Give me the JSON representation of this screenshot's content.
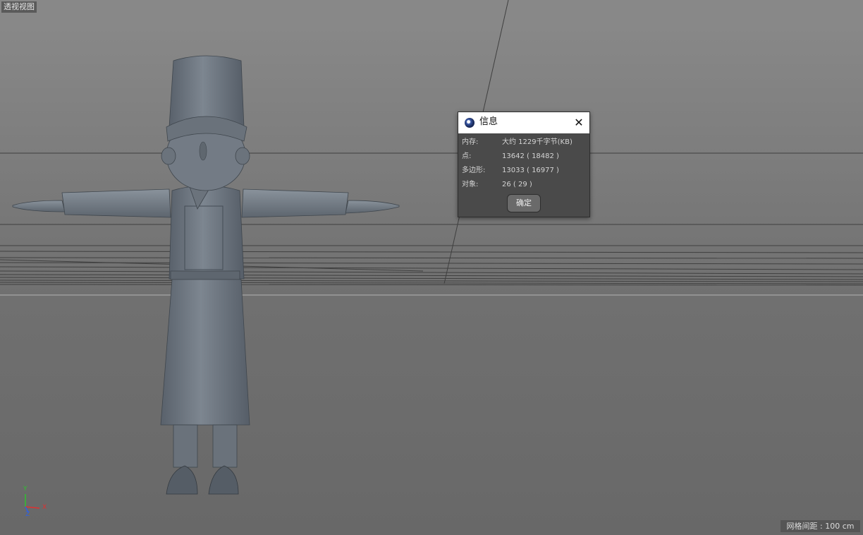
{
  "viewport": {
    "view_label": "透视视图",
    "grid_spacing": "网格间距 : 100 cm",
    "axis_labels": {
      "x": "X",
      "y": "Y",
      "z": "Z"
    }
  },
  "info_dialog": {
    "title": "信息",
    "icon": "cinema4d-app-icon",
    "close_icon": "close-x-icon",
    "rows": [
      {
        "label": "内存:",
        "value": "大约 1229千字节(KB)"
      },
      {
        "label": "点:",
        "value": "13642 ( 18482 )"
      },
      {
        "label": "多边形:",
        "value": "13033 ( 16977 )"
      },
      {
        "label": "对象:",
        "value": "26 ( 29 )"
      }
    ],
    "ok_label": "确定"
  },
  "colors": {
    "background_top": "#8a8a8a",
    "background_bottom": "#686868",
    "model": "#6f7781",
    "dialog_bg": "#4a4a4a",
    "axis_x": "#e03030",
    "axis_y": "#30c030",
    "axis_z": "#3060e0"
  }
}
